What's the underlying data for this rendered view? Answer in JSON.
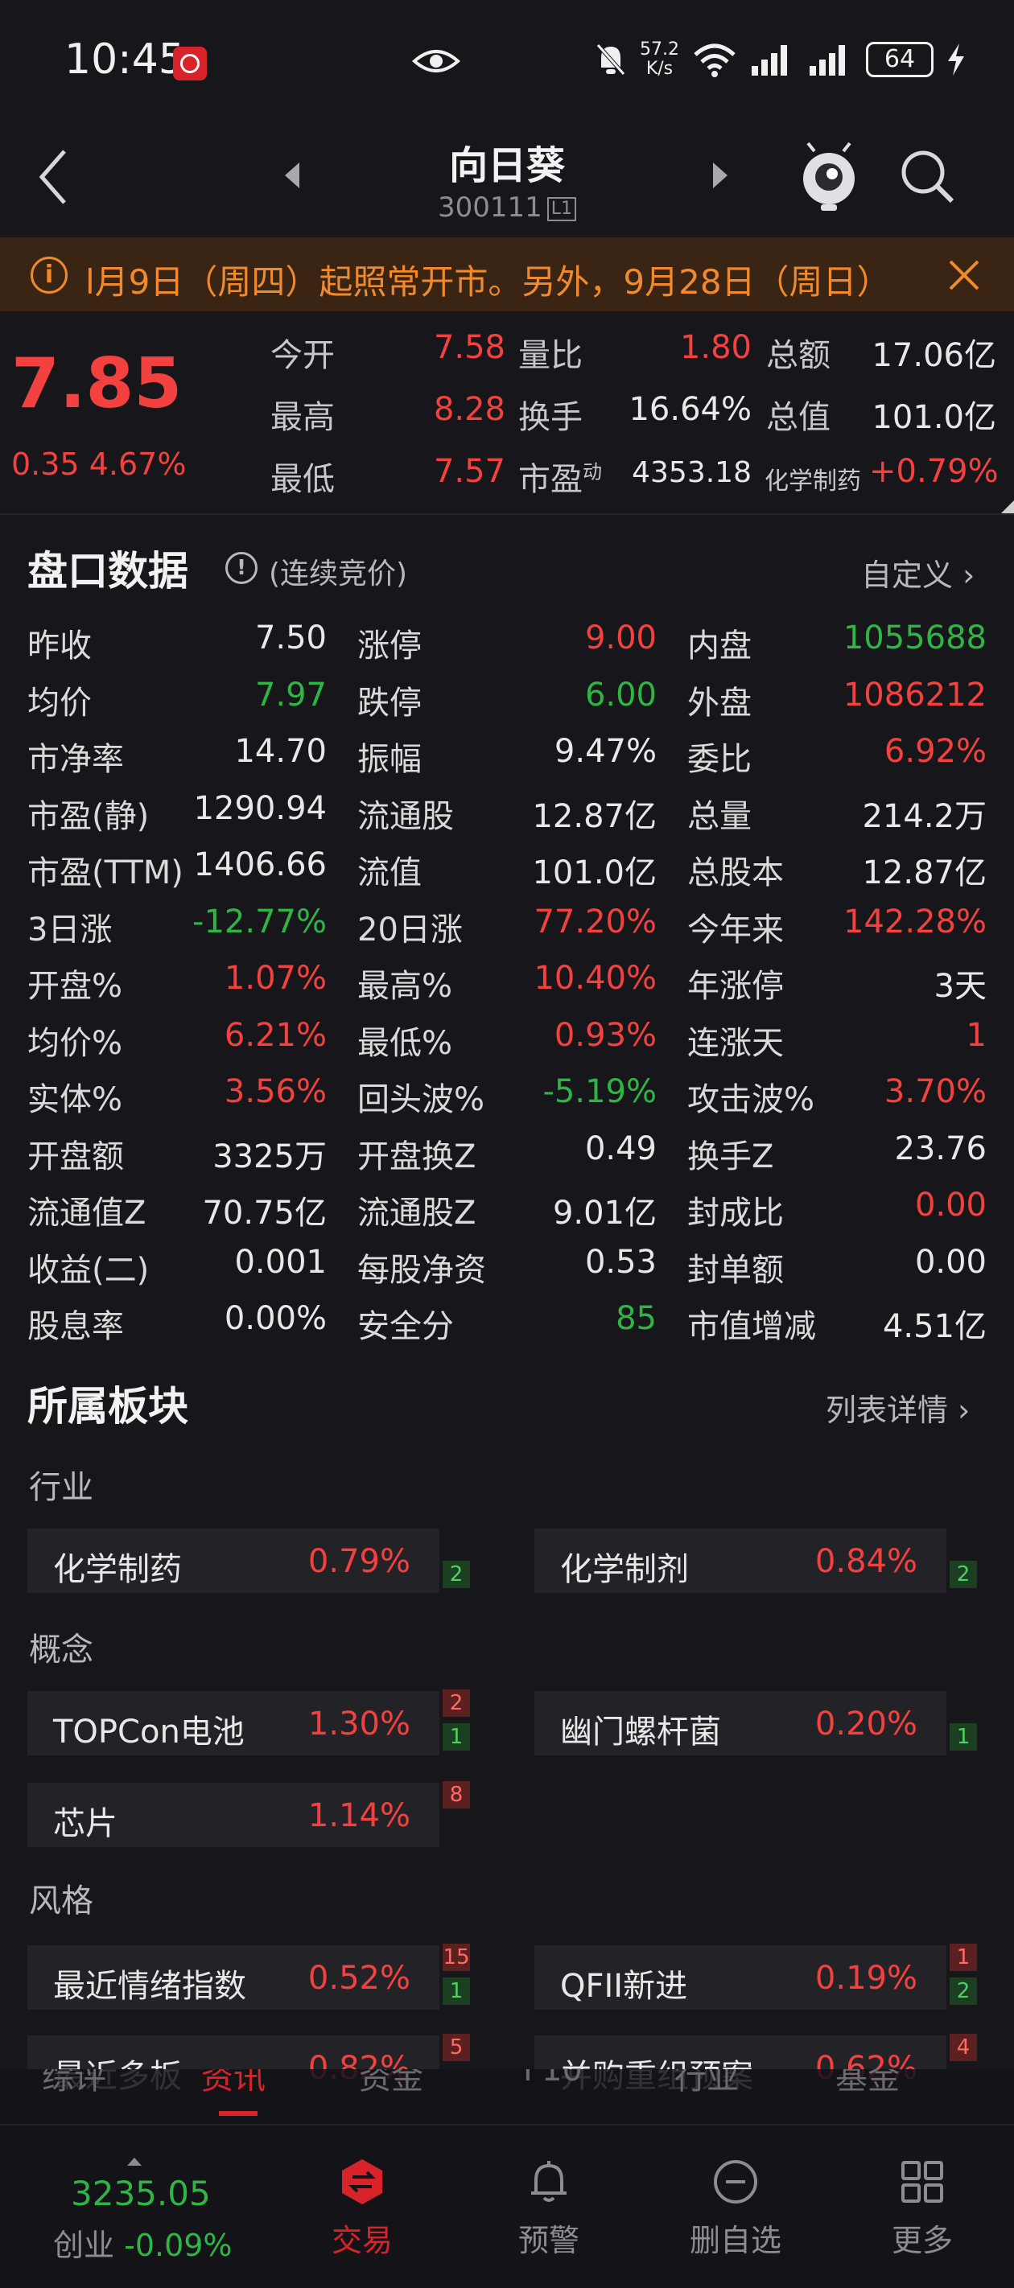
{
  "status": {
    "time": "10:45",
    "net_speed_value": "57.2",
    "net_speed_unit": "K/s",
    "battery": "64"
  },
  "header": {
    "name": "向日葵",
    "code": "300111",
    "level_tag": "L1"
  },
  "notice": {
    "text": "l月9日（周四）起照常开市。另外，9月28日（周日）"
  },
  "quote": {
    "price": "7.85",
    "change": "0.35",
    "change_pct": "4.67%",
    "rows": [
      {
        "l1": "今开",
        "v1": "7.58",
        "l2": "量比",
        "v2": "1.80",
        "l3": "总额",
        "v3": "17.06亿"
      },
      {
        "l1": "最高",
        "v1": "8.28",
        "l2": "换手",
        "v2": "16.64%",
        "l3": "总值",
        "v3": "101.0亿"
      },
      {
        "l1": "最低",
        "v1": "7.57",
        "l2": "市盈",
        "l2_sup": "动",
        "v2": "4353.18",
        "l3": "化学制药",
        "v3": "+0.79%"
      }
    ]
  },
  "pankou": {
    "title": "盘口数据",
    "mode": "(连续竞价)",
    "custom_link": "自定义",
    "rows": [
      [
        {
          "l": "昨收",
          "v": "7.50"
        },
        {
          "l": "涨停",
          "v": "9.00"
        },
        {
          "l": "内盘",
          "v": "1055688"
        }
      ],
      [
        {
          "l": "均价",
          "v": "7.97"
        },
        {
          "l": "跌停",
          "v": "6.00"
        },
        {
          "l": "外盘",
          "v": "1086212"
        }
      ],
      [
        {
          "l": "市净率",
          "v": "14.70"
        },
        {
          "l": "振幅",
          "v": "9.47%"
        },
        {
          "l": "委比",
          "v": "6.92%"
        }
      ],
      [
        {
          "l": "市盈(静)",
          "v": "1290.94"
        },
        {
          "l": "流通股",
          "v": "12.87亿"
        },
        {
          "l": "总量",
          "v": "214.2万"
        }
      ],
      [
        {
          "l": "市盈(TTM)",
          "v": "1406.66"
        },
        {
          "l": "流值",
          "v": "101.0亿"
        },
        {
          "l": "总股本",
          "v": "12.87亿"
        }
      ],
      [
        {
          "l": "3日涨",
          "v": "-12.77%"
        },
        {
          "l": "20日涨",
          "v": "77.20%"
        },
        {
          "l": "今年来",
          "v": "142.28%"
        }
      ],
      [
        {
          "l": "开盘%",
          "v": "1.07%"
        },
        {
          "l": "最高%",
          "v": "10.40%"
        },
        {
          "l": "年涨停",
          "v": "3天"
        }
      ],
      [
        {
          "l": "均价%",
          "v": "6.21%"
        },
        {
          "l": "最低%",
          "v": "0.93%"
        },
        {
          "l": "连涨天",
          "v": "1"
        }
      ],
      [
        {
          "l": "实体%",
          "v": "3.56%"
        },
        {
          "l": "回头波%",
          "v": "-5.19%"
        },
        {
          "l": "攻击波%",
          "v": "3.70%"
        }
      ],
      [
        {
          "l": "开盘额",
          "v": "3325万"
        },
        {
          "l": "开盘换Z",
          "v": "0.49"
        },
        {
          "l": "换手Z",
          "v": "23.76"
        }
      ],
      [
        {
          "l": "流通值Z",
          "v": "70.75亿"
        },
        {
          "l": "流通股Z",
          "v": "9.01亿"
        },
        {
          "l": "封成比",
          "v": "0.00"
        }
      ],
      [
        {
          "l": "收益(二)",
          "v": "0.001"
        },
        {
          "l": "每股净资",
          "v": "0.53"
        },
        {
          "l": "封单额",
          "v": "0.00"
        }
      ],
      [
        {
          "l": "股息率",
          "v": "0.00%"
        },
        {
          "l": "安全分",
          "v": "85"
        },
        {
          "l": "市值增减",
          "v": "4.51亿"
        }
      ]
    ]
  },
  "sectors": {
    "title": "所属板块",
    "list_link": "列表详情",
    "cat_industry": "行业",
    "cat_concept": "概念",
    "cat_style": "风格",
    "chips": [
      {
        "name": "化学制药",
        "pct": "0.79%",
        "up": "",
        "down": "2"
      },
      {
        "name": "化学制剂",
        "pct": "0.84%",
        "up": "",
        "down": "2"
      },
      {
        "name": "TOPCon电池",
        "pct": "1.30%",
        "up": "2",
        "down": "1"
      },
      {
        "name": "幽门螺杆菌",
        "pct": "0.20%",
        "up": "",
        "down": "1"
      },
      {
        "name": "芯片",
        "pct": "1.14%",
        "up": "8",
        "down": ""
      },
      {
        "name": "最近情绪指数",
        "pct": "0.52%",
        "up": "15",
        "down": "1"
      },
      {
        "name": "QFII新进",
        "pct": "0.19%",
        "up": "1",
        "down": "2"
      },
      {
        "name": "最近多板",
        "pct": "0.82%",
        "up": "5",
        "down": ""
      },
      {
        "name": "并购重组预案",
        "pct": "0.62%",
        "up": "4",
        "down": ""
      }
    ]
  },
  "subtabs": [
    "综评",
    "资讯",
    "资金",
    "F10",
    "行业",
    "基金"
  ],
  "bottom_nav": {
    "index_value": "3235.05",
    "index_name": "创业",
    "index_change": "-0.09%",
    "items": [
      "交易",
      "预警",
      "删自选",
      "更多"
    ]
  },
  "colors": {
    "up": "#f2413f",
    "down": "#2fb544",
    "accent": "#d8232a",
    "notice": "#f08a2c",
    "background": "#17171b"
  }
}
